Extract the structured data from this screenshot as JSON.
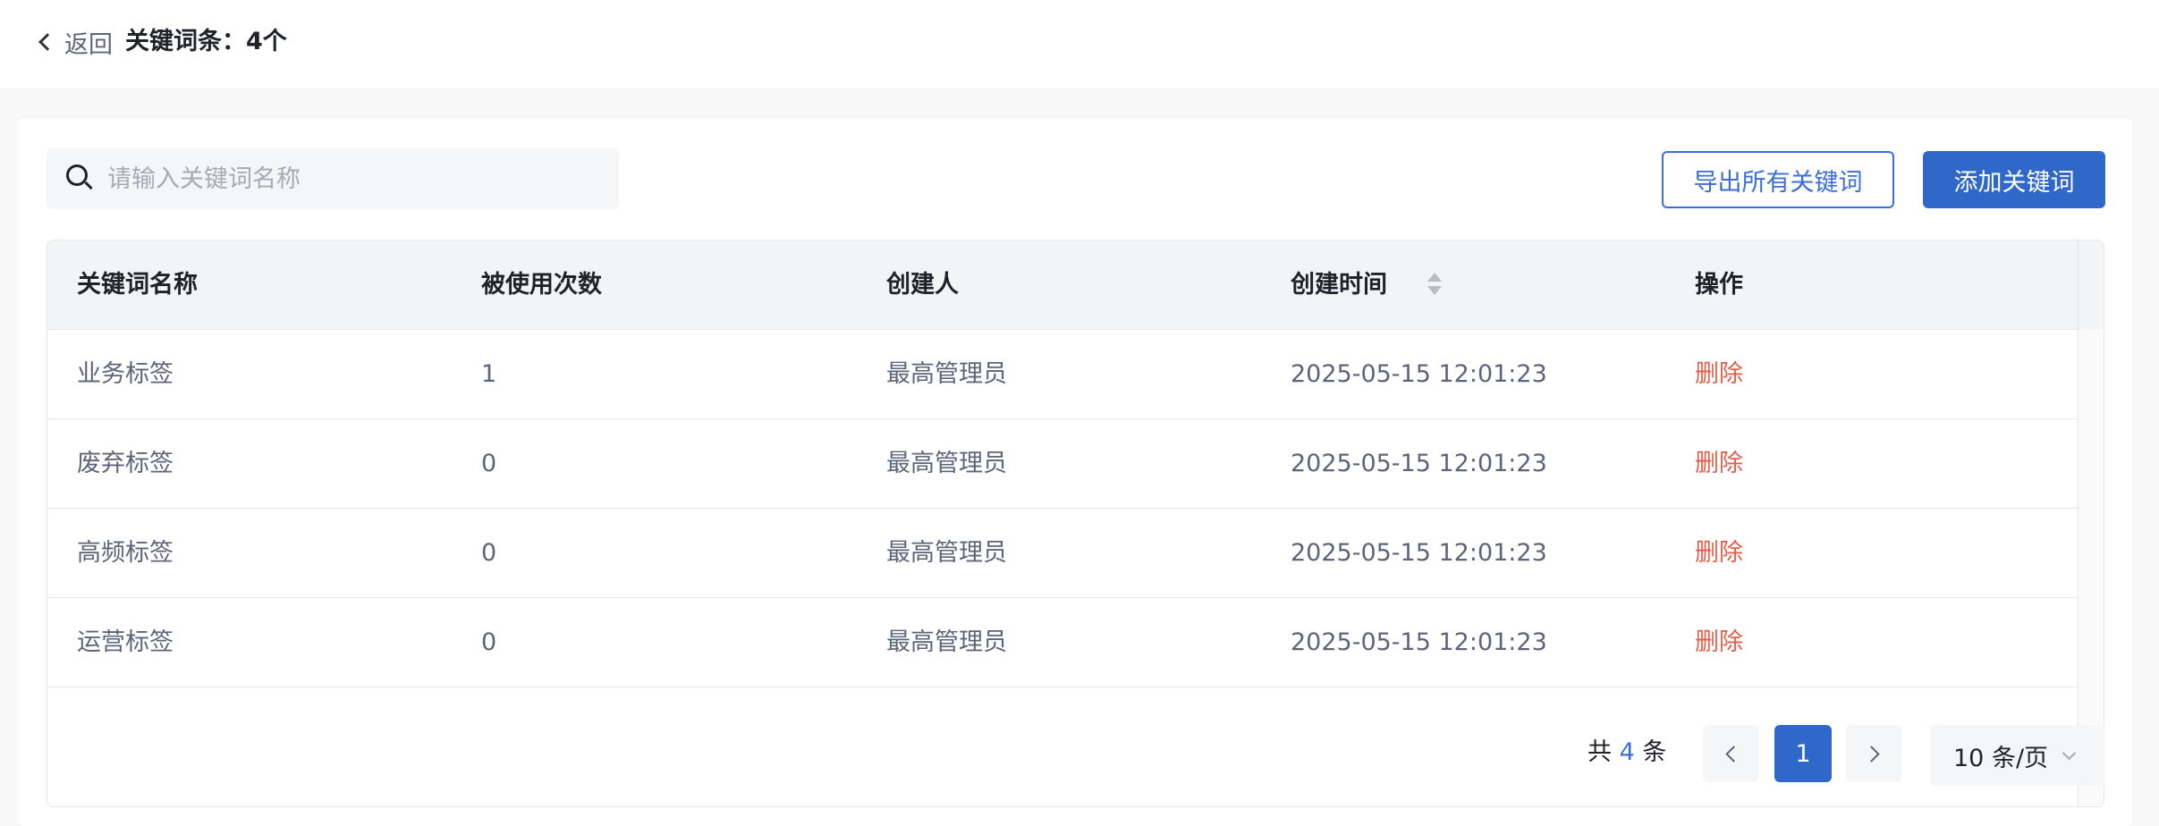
{
  "header": {
    "back_label": "返回",
    "title": "关键词条：4个"
  },
  "toolbar": {
    "search_placeholder": "请输入关键词名称",
    "export_label": "导出所有关键词",
    "add_label": "添加关键词"
  },
  "table": {
    "columns": [
      "关键词名称",
      "被使用次数",
      "创建人",
      "创建时间",
      "操作"
    ],
    "rows": [
      {
        "name": "业务标签",
        "count": "1",
        "creator": "最高管理员",
        "created": "2025-05-15 12:01:23",
        "action": "删除"
      },
      {
        "name": "废弃标签",
        "count": "0",
        "creator": "最高管理员",
        "created": "2025-05-15 12:01:23",
        "action": "删除"
      },
      {
        "name": "高频标签",
        "count": "0",
        "creator": "最高管理员",
        "created": "2025-05-15 12:01:23",
        "action": "删除"
      },
      {
        "name": "运营标签",
        "count": "0",
        "creator": "最高管理员",
        "created": "2025-05-15 12:01:23",
        "action": "删除"
      }
    ]
  },
  "pagination": {
    "total_prefix": "共",
    "total": "4",
    "total_suffix": "条",
    "current_page": "1",
    "page_size": "10 条/页"
  },
  "colors": {
    "primary": "#2f68c8",
    "danger": "#e0604b",
    "link": "#3b6fd4"
  }
}
